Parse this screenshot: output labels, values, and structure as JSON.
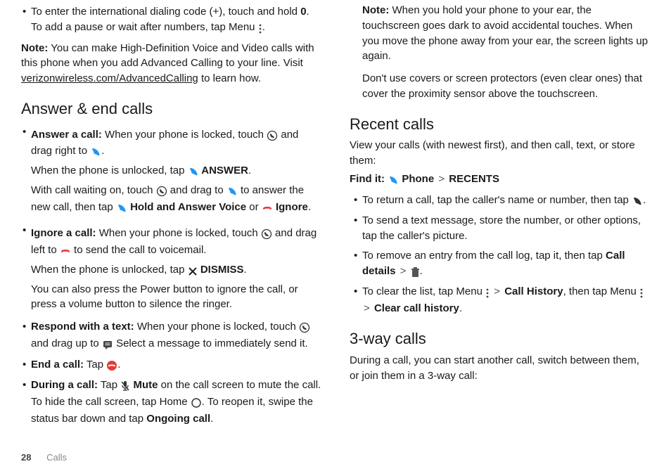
{
  "col1": {
    "intl_dialing": "To enter the international dialing code (+), touch and hold ",
    "zero": "0",
    "intl_after": ". To add a pause or wait after numbers, tap Menu ",
    "note_label": "Note:",
    "note_body": " You can make High-Definition Voice and Video calls with this phone when you add Advanced Calling to your line. Visit ",
    "note_link": "verizonwireless.com/AdvancedCalling",
    "note_end": " to learn how.",
    "heading_answer": "Answer & end calls",
    "answer_label": "Answer a call:",
    "answer_1a": " When your phone is locked, touch ",
    "answer_1b": " and drag right to ",
    "answer_2a": "When the phone is unlocked, tap ",
    "answer_2b": " ANSWER",
    "answer_3a": "With call waiting on, touch ",
    "answer_3b": " and drag to ",
    "answer_3c": " to answer the new call, then tap ",
    "answer_3d": " Hold and Answer Voice",
    "answer_3e": " or ",
    "answer_3f": " Ignore",
    "ignore_label": "Ignore a call:",
    "ignore_1a": " When your phone is locked, touch ",
    "ignore_1b": " and drag left to ",
    "ignore_1c": " to send the call to voicemail.",
    "ignore_2a": "When the phone is unlocked, tap ",
    "ignore_2b": " DISMISS",
    "ignore_3": "You can also press the Power button to ignore the call, or press a volume button to silence the ringer.",
    "respond_label": "Respond with a text:",
    "respond_1a": " When your phone is locked, touch ",
    "respond_1b": " and drag up to ",
    "respond_1c": "  Select a message to immediately send it.",
    "end_label": "End a call:",
    "end_body": " Tap ",
    "during_label": "During a call:",
    "during_1a": " Tap ",
    "during_1b": " Mute",
    "during_1c": " on the call screen to mute the call. To hide the call screen, tap Home ",
    "during_1d": ". To reopen it, swipe the status bar down and tap ",
    "during_1e": "Ongoing call"
  },
  "col2": {
    "note_label": "Note:",
    "note_body": " When you hold your phone to your ear, the touchscreen goes dark to avoid accidental touches. When you move the phone away from your ear, the screen lights up again.",
    "note2": "Don't use covers or screen protectors (even clear ones) that cover the proximity sensor above the touchscreen.",
    "heading_recent": "Recent calls",
    "recent_intro": "View your calls (with newest first), and then call, text, or store them:",
    "findit": "Find it:",
    "phone": " Phone",
    "recents": "RECENTS",
    "r1a": "To return a call, tap the caller's name or number, then tap ",
    "r2": "To send a text message, store the number, or other options, tap the caller's picture.",
    "r3a": "To remove an entry from the call log, tap it, then tap ",
    "r3b": "Call details",
    "r4a": "To clear the list, tap Menu ",
    "r4b": "Call History",
    "r4c": ", then tap Menu ",
    "r4d": "Clear call history",
    "heading_3way": "3-way calls",
    "threeway_body": "During a call, you can start another call, switch between them, or join them in a 3-way call:"
  },
  "footer": {
    "page": "28",
    "section": "Calls"
  }
}
